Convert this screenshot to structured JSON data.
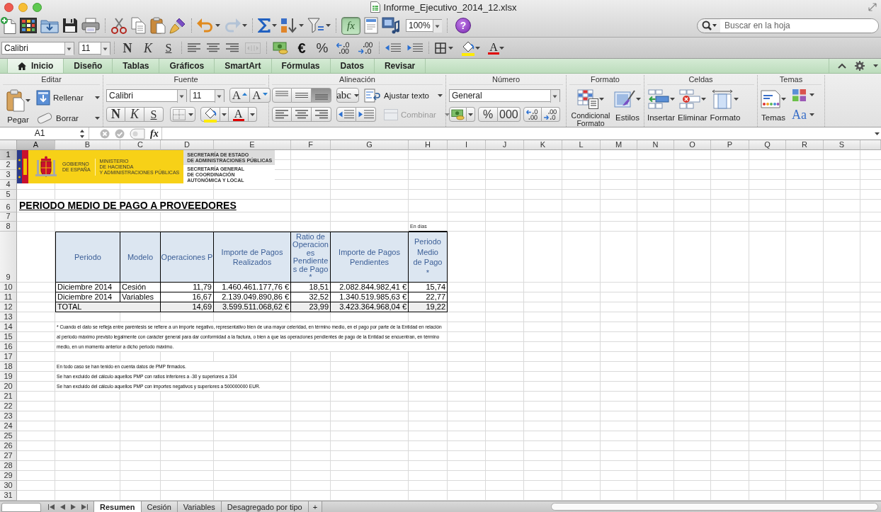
{
  "window": {
    "title": "Informe_Ejecutivo_2014_12.xlsx"
  },
  "standard_toolbar": {
    "redo": {
      "disabled": true
    },
    "formula_builder": {
      "label": "fx",
      "on": true
    },
    "zoom": "100%",
    "help": "?",
    "search": {
      "placeholder": "Buscar en la hoja"
    }
  },
  "formatting_toolbar": {
    "font": "Calibri",
    "size": "11",
    "bold": "N",
    "italic": "K",
    "underline": "S",
    "merge": {
      "disabled": true
    },
    "currency": "€",
    "percent": "%",
    "font_color": "A"
  },
  "ribbon": {
    "tabs": [
      {
        "label": "Inicio",
        "selected": true
      },
      {
        "label": "Diseño",
        "selected": false
      },
      {
        "label": "Tablas",
        "selected": false
      },
      {
        "label": "Gráficos",
        "selected": false
      },
      {
        "label": "SmartArt",
        "selected": false
      },
      {
        "label": "Fórmulas",
        "selected": false
      },
      {
        "label": "Datos",
        "selected": false
      },
      {
        "label": "Revisar",
        "selected": false
      }
    ],
    "groups": [
      {
        "kind": "edit",
        "title": "Editar",
        "paste": "Pegar",
        "fill": "Rellenar",
        "clear": "Borrar"
      },
      {
        "kind": "font",
        "title": "Fuente",
        "font": "Calibri",
        "size": "11",
        "grow": "A",
        "shrink": "A",
        "bold": "N",
        "italic": "K",
        "underline": "S",
        "font_color": "A"
      },
      {
        "kind": "alignment",
        "title": "Alineación",
        "vertical": [
          {
            "selected": false
          },
          {
            "selected": false
          },
          {
            "selected": true
          }
        ],
        "orientation": "abc",
        "wrap": "Ajustar texto",
        "merge": {
          "label": "Combinar",
          "disabled": true
        }
      },
      {
        "kind": "number",
        "title": "Número",
        "format": "General",
        "percent": "%",
        "thousands": "000"
      },
      {
        "kind": "format",
        "title": "Formato",
        "conditional": "Condicional Formato",
        "styles": "Estilos"
      },
      {
        "kind": "cells",
        "title": "Celdas",
        "insert": "Insertar",
        "delete": "Eliminar",
        "format": "Formato"
      },
      {
        "kind": "themes",
        "title": "Temas",
        "themes": "Temas",
        "fonts": "Aa"
      }
    ]
  },
  "formula_bar": {
    "name_box": "A1",
    "fx": "fx"
  },
  "sheet": {
    "column_headers": [
      {
        "label": "A",
        "selected": true
      },
      {
        "label": "B",
        "selected": false
      },
      {
        "label": "C",
        "selected": false
      },
      {
        "label": "D",
        "selected": false
      },
      {
        "label": "E",
        "selected": false
      },
      {
        "label": "F",
        "selected": false
      },
      {
        "label": "G",
        "selected": false
      },
      {
        "label": "H",
        "selected": false
      },
      {
        "label": "I",
        "selected": false
      },
      {
        "label": "J",
        "selected": false
      },
      {
        "label": "K",
        "selected": false
      },
      {
        "label": "L",
        "selected": false
      },
      {
        "label": "M",
        "selected": false
      },
      {
        "label": "N",
        "selected": false
      },
      {
        "label": "O",
        "selected": false
      },
      {
        "label": "P",
        "selected": false
      },
      {
        "label": "Q",
        "selected": false
      },
      {
        "label": "R",
        "selected": false
      },
      {
        "label": "S",
        "selected": false
      }
    ],
    "row_headers": [
      {
        "label": "1",
        "selected": true
      },
      {
        "label": "2",
        "selected": false
      },
      {
        "label": "3",
        "selected": false
      },
      {
        "label": "4",
        "selected": false
      },
      {
        "label": "5",
        "selected": false
      },
      {
        "label": "6",
        "selected": false
      },
      {
        "label": "7",
        "selected": false
      },
      {
        "label": "8",
        "selected": false
      },
      {
        "label": "9",
        "selected": false
      },
      {
        "label": "10",
        "selected": false
      },
      {
        "label": "11",
        "selected": false
      },
      {
        "label": "12",
        "selected": false
      },
      {
        "label": "13",
        "selected": false
      },
      {
        "label": "14",
        "selected": false
      },
      {
        "label": "15",
        "selected": false
      },
      {
        "label": "16",
        "selected": false
      },
      {
        "label": "17",
        "selected": false
      },
      {
        "label": "18",
        "selected": false
      },
      {
        "label": "19",
        "selected": false
      },
      {
        "label": "20",
        "selected": false
      },
      {
        "label": "21",
        "selected": false
      },
      {
        "label": "22",
        "selected": false
      },
      {
        "label": "23",
        "selected": false
      },
      {
        "label": "24",
        "selected": false
      },
      {
        "label": "25",
        "selected": false
      },
      {
        "label": "26",
        "selected": false
      },
      {
        "label": "27",
        "selected": false
      },
      {
        "label": "28",
        "selected": false
      },
      {
        "label": "29",
        "selected": false
      },
      {
        "label": "30",
        "selected": false
      },
      {
        "label": "31",
        "selected": false
      }
    ],
    "logo": {
      "government": "GOBIERNO\nDE ESPAÑA",
      "ministry": "MINISTERIO\nDE HACIENDA\nY ADMINISTRACIONES PÚBLICAS",
      "secretariat": "SECRETARÍA DE ESTADO\nDE ADMINISTRACIONES PÚBLICAS",
      "general_secretariat": "SECRETARÍA GENERAL\nDE COORDINACIÓN\nAUTONÓMICA Y LOCAL"
    },
    "title": "PERIODO MEDIO DE PAGO A PROVEEDORES",
    "unit": "En días",
    "table": {
      "columns": [
        "Periodo",
        "Modelo",
        "Operaciones P",
        "Importe de Pagos Realizados",
        "Ratio de Operaciones Pendientes de Pago *",
        "Importe de Pagos Pendientes",
        "Periodo Medio de Pago *"
      ],
      "rows": [
        {
          "kind": "data",
          "cells": [
            "Diciembre 2014",
            "Cesión",
            "11,79",
            "1.460.461.177,76 €",
            "18,51",
            "2.082.844.982,41 €",
            "15,74"
          ]
        },
        {
          "kind": "data",
          "cells": [
            "Diciembre 2014",
            "Variables",
            "16,67",
            "2.139.049.890,86 €",
            "32,52",
            "1.340.519.985,63 €",
            "22,77"
          ]
        },
        {
          "kind": "total",
          "cells": [
            "TOTAL",
            "",
            "14,69",
            "3.599.511.068,62 €",
            "23,99",
            "3.423.364.968,04 €",
            "19,22"
          ]
        }
      ]
    },
    "footnote": "* Cuando el dato se refleja entre paréntesis se refiere a un importe negativo, representativo bien de una mayor celeridad, en término medio, en el pago por parte de la Entidad en relación al periodo máximo previsto legalmente con carácter general para dar conformidad a la factura, o bien a que las operaciones pendientes de pago de la Entidad se encuentran, en término medio, en un momento anterior a dicho periodo máximo.",
    "notes": [
      "En todo caso se han tenido en cuenta datos de PMP firmados.",
      "Se han excluido del cálculo aquellos PMP con ratios inferiores a -30 y superiores a 334",
      "Se han excluido del cálculo aquellos PMP con importes negativos y superiores a 500000000 EUR."
    ]
  },
  "sheet_tabs": [
    {
      "label": "Resumen",
      "selected": true
    },
    {
      "label": "Cesión",
      "selected": false
    },
    {
      "label": "Variables",
      "selected": false
    },
    {
      "label": "Desagregado por tipo",
      "selected": false
    }
  ],
  "add_sheet": "+"
}
